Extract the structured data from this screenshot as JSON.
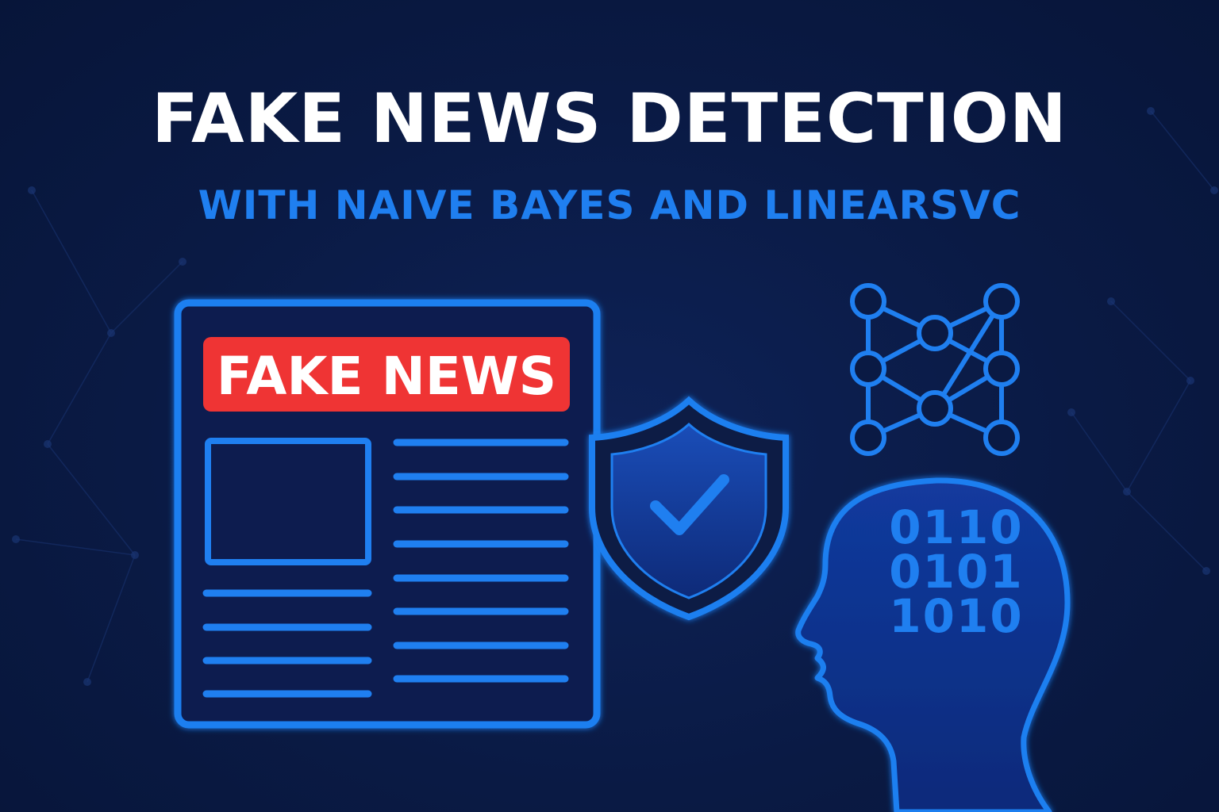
{
  "title": "FAKE NEWS DETECTION",
  "subtitle": "WITH NAIVE BAYES AND LINEARSVC",
  "newspaper": {
    "badge_label": "FAKE NEWS"
  },
  "head": {
    "binary_lines": [
      "0110",
      "0101",
      "1010"
    ]
  },
  "icons": {
    "newspaper": "newspaper-icon",
    "shield": "shield-check-icon",
    "network": "neural-network-icon",
    "head": "human-head-icon"
  },
  "colors": {
    "background": "#0a1a44",
    "accent_blue": "#1f7ff0",
    "badge_red": "#ef3434",
    "title_white": "#ffffff"
  }
}
